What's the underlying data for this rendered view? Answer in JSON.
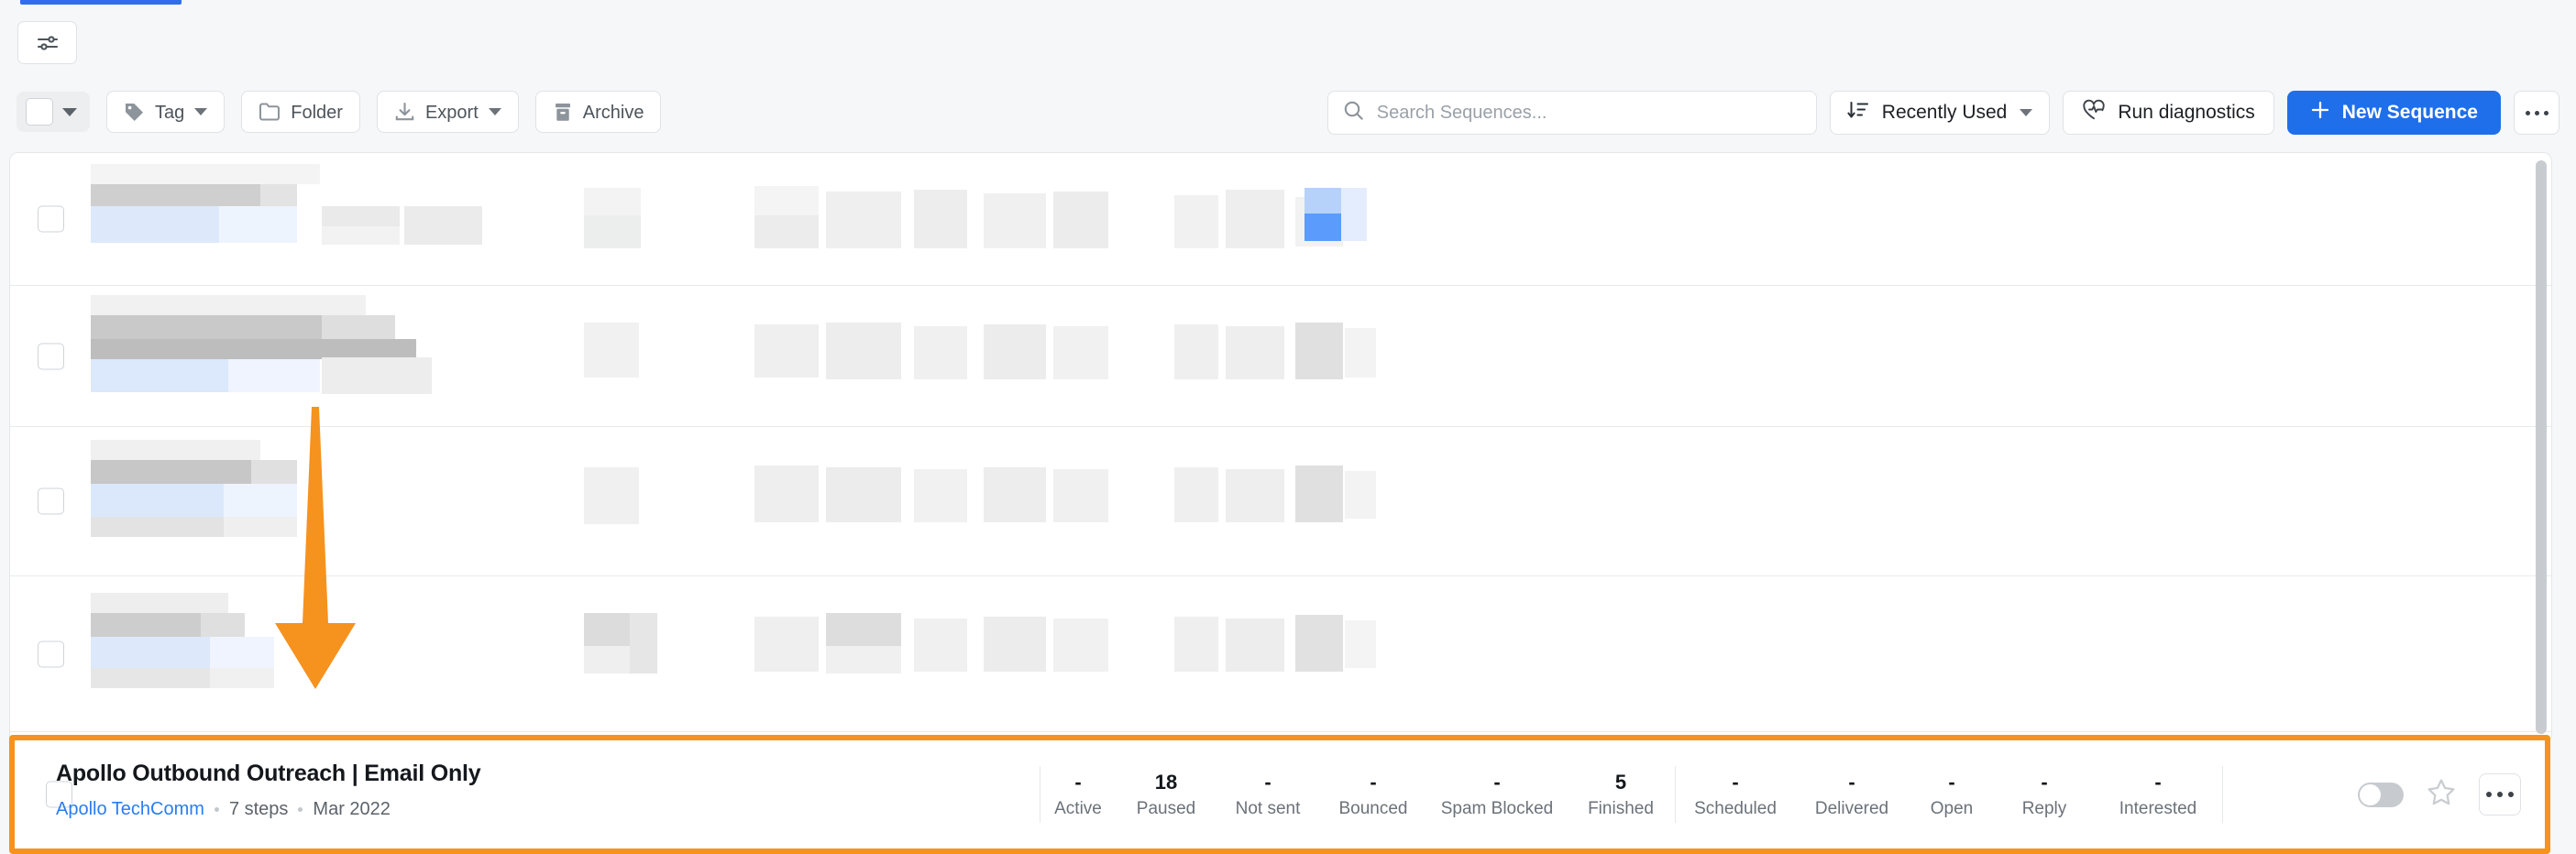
{
  "window": {
    "active_tab_indicator": true
  },
  "filterbar": {
    "filter_button_icon": "sliders-icon"
  },
  "toolbar": {
    "select_all_checkbox_label": "",
    "select_all_caret_icon": "chevron-down-icon",
    "buttons": [
      {
        "label": "Tag",
        "icon": "tag-icon",
        "has_caret": true
      },
      {
        "label": "Folder",
        "icon": "folder-icon",
        "has_caret": false
      },
      {
        "label": "Export",
        "icon": "download-icon",
        "has_caret": true
      },
      {
        "label": "Archive",
        "icon": "archive-icon",
        "has_caret": false
      }
    ],
    "search": {
      "placeholder": "Search Sequences...",
      "value": "",
      "icon": "search-icon"
    },
    "sort": {
      "label": "Recently Used",
      "icon": "sort-descending-icon",
      "caret_icon": "chevron-down-icon"
    },
    "diagnostics": {
      "label": "Run diagnostics",
      "icon": "heartbeat-icon"
    },
    "new_sequence": {
      "label": "New Sequence",
      "icon": "plus-icon"
    },
    "overflow": {
      "icon": "kebab-horizontal-icon"
    }
  },
  "list": {
    "redacted_rows": [
      {
        "index": 1,
        "redacted": true,
        "toggle_state": "on"
      },
      {
        "index": 2,
        "redacted": true,
        "toggle_state": "off"
      },
      {
        "index": 3,
        "redacted": true,
        "toggle_state": "off"
      },
      {
        "index": 4,
        "redacted": true,
        "toggle_state": "off"
      }
    ],
    "highlighted_row": {
      "checkbox_checked": false,
      "title": "Apollo Outbound Outreach | Email Only",
      "owner": "Apollo TechComm",
      "steps": "7 steps",
      "date": "Mar 2022",
      "separator": "•",
      "stats": [
        {
          "value": "-",
          "label": "Active"
        },
        {
          "value": "18",
          "label": "Paused"
        },
        {
          "value": "-",
          "label": "Not sent"
        },
        {
          "value": "-",
          "label": "Bounced"
        },
        {
          "value": "-",
          "label": "Spam Blocked"
        },
        {
          "value": "5",
          "label": "Finished"
        },
        {
          "value": "-",
          "label": "Scheduled"
        },
        {
          "value": "-",
          "label": "Delivered"
        },
        {
          "value": "-",
          "label": "Open"
        },
        {
          "value": "-",
          "label": "Reply"
        },
        {
          "value": "-",
          "label": "Interested"
        }
      ],
      "toggle_state": "off",
      "star_state": "unstarred",
      "overflow_icon": "kebab-horizontal-icon"
    }
  },
  "annotation": {
    "type": "arrow",
    "direction": "down",
    "color": "#f6921e",
    "highlight_border_color": "#f6921e"
  },
  "colors": {
    "accent_blue": "#1f6feb",
    "link_blue": "#2b7cf3",
    "annotation_orange": "#f6921e",
    "page_bg": "#f6f7f8",
    "panel_bg": "#ffffff",
    "border": "#e4e6e9",
    "text_primary": "#14181c",
    "text_muted": "#6b7279"
  },
  "scrollbar": {
    "orientation": "vertical",
    "position": "top"
  }
}
